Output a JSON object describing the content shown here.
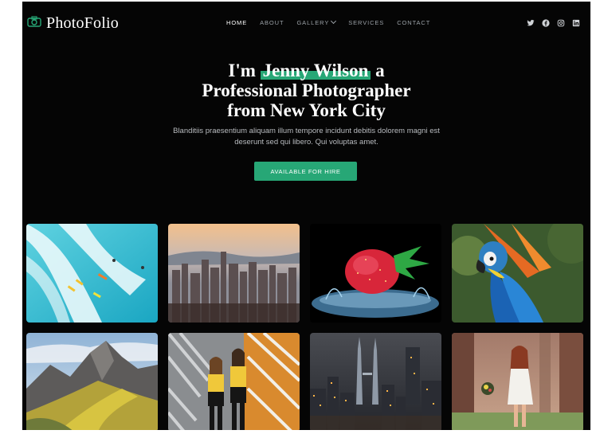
{
  "header": {
    "logo_icon": "camera-icon",
    "logo_text": "PhotoFolio",
    "nav": [
      {
        "label": "HOME",
        "active": true
      },
      {
        "label": "ABOUT"
      },
      {
        "label": "GALLERY",
        "has_dropdown": true
      },
      {
        "label": "SERVICES"
      },
      {
        "label": "CONTACT"
      }
    ],
    "socials": [
      "twitter-icon",
      "facebook-icon",
      "instagram-icon",
      "linkedin-icon"
    ]
  },
  "hero": {
    "title_prefix": "I'm",
    "title_name": "Jenny Wilson",
    "title_suffix": "a",
    "title_line2": "Professional Photographer",
    "title_line3": "from New York City",
    "subtitle": "Blanditiis praesentium aliquam illum tempore incidunt debitis dolorem magni est deserunt sed qui libero. Qui voluptas amet.",
    "cta_label": "AVAILABLE FOR HIRE"
  },
  "gallery": {
    "items": [
      "surfers-photo",
      "city-skyline-photo",
      "strawberry-splash-photo",
      "parrot-photo",
      "mountain-photo",
      "fashion-models-photo",
      "night-city-photo",
      "woman-forest-photo"
    ]
  },
  "colors": {
    "accent": "#27a776",
    "background": "#050505",
    "text": "#ffffff",
    "muted": "#9aa0a6"
  }
}
